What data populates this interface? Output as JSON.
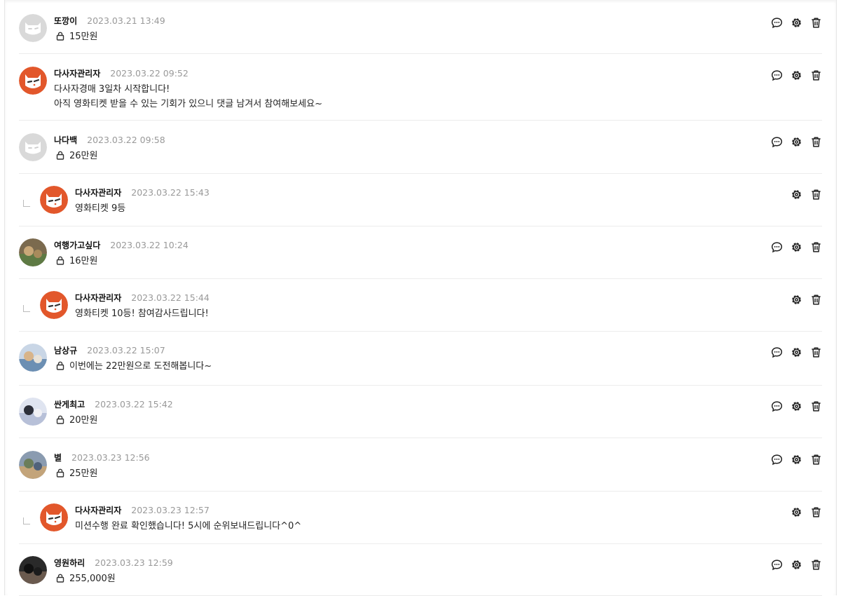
{
  "comments": [
    {
      "author": "또깡이",
      "date": "2023.03.21 13:49",
      "lines": [
        "15만원"
      ],
      "secret": true,
      "reply": false,
      "avatar": "default",
      "can_reply": true
    },
    {
      "author": "다사자관리자",
      "date": "2023.03.22 09:52",
      "lines": [
        "다사자경매 3일차 시작합니다!",
        "아직 영화티켓 받을 수 있는 기회가 있으니 댓글 남겨서 참여해보세요~"
      ],
      "secret": false,
      "reply": false,
      "avatar": "admin",
      "can_reply": true
    },
    {
      "author": "나다백",
      "date": "2023.03.22 09:58",
      "lines": [
        "26만원"
      ],
      "secret": true,
      "reply": false,
      "avatar": "default",
      "can_reply": true
    },
    {
      "author": "다사자관리자",
      "date": "2023.03.22 15:43",
      "lines": [
        "영화티켓 9등"
      ],
      "secret": false,
      "reply": true,
      "avatar": "admin",
      "can_reply": false
    },
    {
      "author": "여행가고싶다",
      "date": "2023.03.22 10:24",
      "lines": [
        "16만원"
      ],
      "secret": true,
      "reply": false,
      "avatar": "photo-landscape",
      "can_reply": true
    },
    {
      "author": "다사자관리자",
      "date": "2023.03.22 15:44",
      "lines": [
        "영화티켓 10등! 참여감사드립니다!"
      ],
      "secret": false,
      "reply": true,
      "avatar": "admin",
      "can_reply": false
    },
    {
      "author": "남상규",
      "date": "2023.03.22 15:07",
      "lines": [
        "이번에는 22만원으로 도전해봅니다~"
      ],
      "secret": true,
      "reply": false,
      "avatar": "photo-group",
      "can_reply": true
    },
    {
      "author": "싼게최고",
      "date": "2023.03.22 15:42",
      "lines": [
        "20만원"
      ],
      "secret": true,
      "reply": false,
      "avatar": "photo-phone",
      "can_reply": true
    },
    {
      "author": "별",
      "date": "2023.03.23 12:56",
      "lines": [
        "25만원"
      ],
      "secret": true,
      "reply": false,
      "avatar": "photo-people",
      "can_reply": true
    },
    {
      "author": "다사자관리자",
      "date": "2023.03.23 12:57",
      "lines": [
        "미션수행 완료 확인했습니다! 5시에 순위보내드립니다^0^"
      ],
      "secret": false,
      "reply": true,
      "avatar": "admin",
      "can_reply": false
    },
    {
      "author": "영원하리",
      "date": "2023.03.23 12:59",
      "lines": [
        "255,000원"
      ],
      "secret": true,
      "reply": false,
      "avatar": "photo-portrait",
      "can_reply": true
    }
  ],
  "icons": {
    "reply": "chat-bubble-icon",
    "settings": "gear-icon",
    "delete": "trash-icon",
    "secret": "lock-icon"
  },
  "colors": {
    "admin_avatar": "#e2572b",
    "default_avatar": "#d9d9d9",
    "divider": "#ececec",
    "date": "#999999"
  }
}
